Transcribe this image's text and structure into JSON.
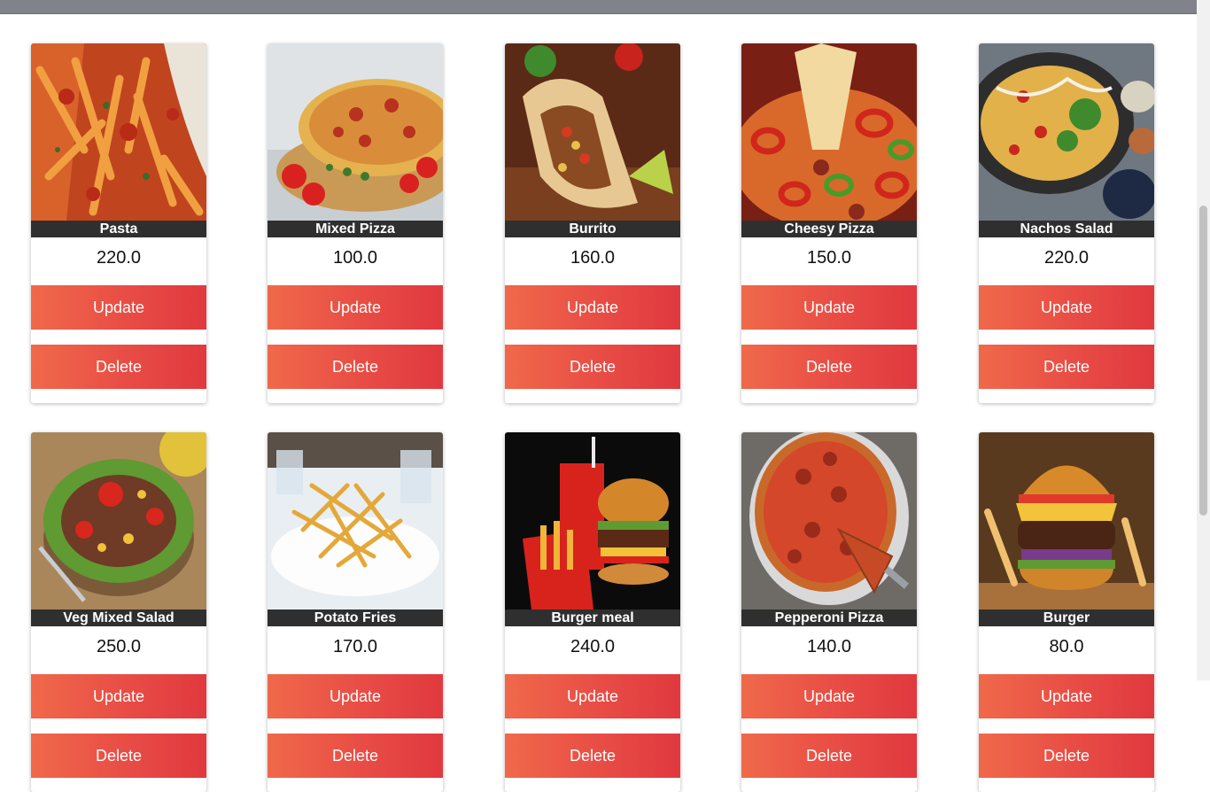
{
  "items": [
    {
      "name": "Pasta",
      "price": "220.0",
      "update_label": "Update",
      "delete_label": "Delete"
    },
    {
      "name": "Mixed Pizza",
      "price": "100.0",
      "update_label": "Update",
      "delete_label": "Delete"
    },
    {
      "name": "Burrito",
      "price": "160.0",
      "update_label": "Update",
      "delete_label": "Delete"
    },
    {
      "name": "Cheesy Pizza",
      "price": "150.0",
      "update_label": "Update",
      "delete_label": "Delete"
    },
    {
      "name": "Nachos Salad",
      "price": "220.0",
      "update_label": "Update",
      "delete_label": "Delete"
    },
    {
      "name": "Veg Mixed Salad",
      "price": "250.0",
      "update_label": "Update",
      "delete_label": "Delete"
    },
    {
      "name": "Potato Fries",
      "price": "170.0",
      "update_label": "Update",
      "delete_label": "Delete"
    },
    {
      "name": "Burger meal",
      "price": "240.0",
      "update_label": "Update",
      "delete_label": "Delete"
    },
    {
      "name": "Pepperoni Pizza",
      "price": "140.0",
      "update_label": "Update",
      "delete_label": "Delete"
    },
    {
      "name": "Burger",
      "price": "80.0",
      "update_label": "Update",
      "delete_label": "Delete"
    }
  ],
  "colors": {
    "button_gradient_start": "#f0694a",
    "button_gradient_end": "#e0393f",
    "title_bar": "#2f2f2f",
    "top_bar": "#80848a"
  }
}
